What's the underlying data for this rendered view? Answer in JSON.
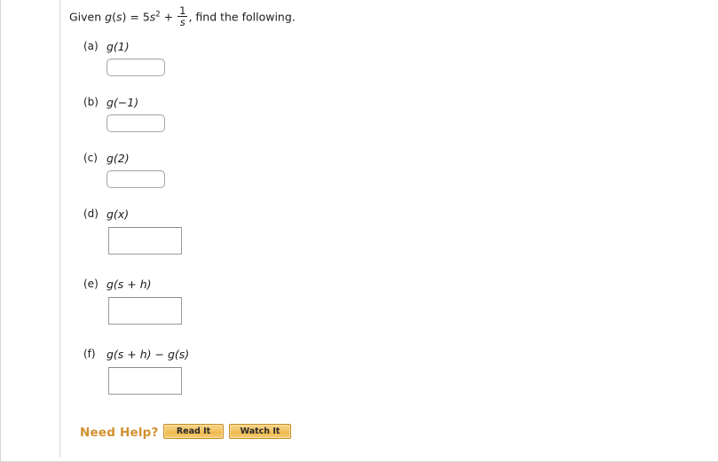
{
  "problem": {
    "given_prefix": "Given ",
    "function_name": "g",
    "variable": "s",
    "equals": " = ",
    "term1_coeff": "5",
    "term1_base": "s",
    "term1_exponent": "2",
    "plus": " + ",
    "fraction_numerator": "1",
    "fraction_denominator": "s",
    "suffix": ", find the following."
  },
  "parts": [
    {
      "label": "(a)",
      "expression": "g(1)",
      "answer_value": "",
      "box_style": "small"
    },
    {
      "label": "(b)",
      "expression": "g(−1)",
      "answer_value": "",
      "box_style": "small"
    },
    {
      "label": "(c)",
      "expression": "g(2)",
      "answer_value": "",
      "box_style": "small"
    },
    {
      "label": "(d)",
      "expression": "g(x)",
      "answer_value": "",
      "box_style": "large"
    },
    {
      "label": "(e)",
      "expression": "g(s + h)",
      "answer_value": "",
      "box_style": "large"
    },
    {
      "label": "(f)",
      "expression": "g(s + h) − g(s)",
      "answer_value": "",
      "box_style": "large"
    }
  ],
  "need_help": {
    "label": "Need Help?",
    "read_it_label": "Read It",
    "watch_it_label": "Watch It",
    "accent_color": "#d2902f",
    "button_border_color": "#c98a22"
  }
}
